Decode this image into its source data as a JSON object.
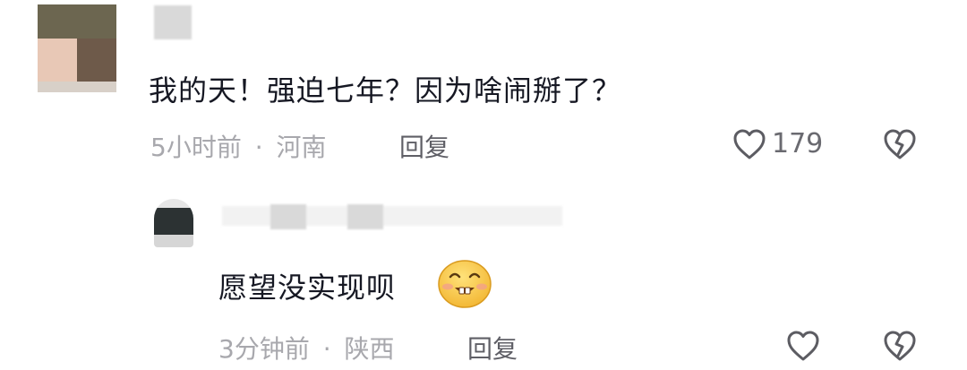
{
  "comments": [
    {
      "text": "我的天！强迫七年？因为啥闹掰了？",
      "time": "5小时前",
      "separator": "·",
      "location": "河南",
      "reply_label": "回复",
      "like_count": "179",
      "icons": {
        "like": "heart-outline-icon",
        "dislike": "broken-heart-icon"
      }
    },
    {
      "text": "愿望没实现呗",
      "emoji": "smiling-face-emoji",
      "time": "3分钟前",
      "separator": "·",
      "location": "陕西",
      "reply_label": "回复",
      "icons": {
        "like": "heart-outline-icon",
        "dislike": "broken-heart-icon"
      }
    }
  ],
  "colors": {
    "text": "#161823",
    "meta": "#a8a8ad",
    "reply": "#5f5f66",
    "emoji": "#f7c948"
  }
}
